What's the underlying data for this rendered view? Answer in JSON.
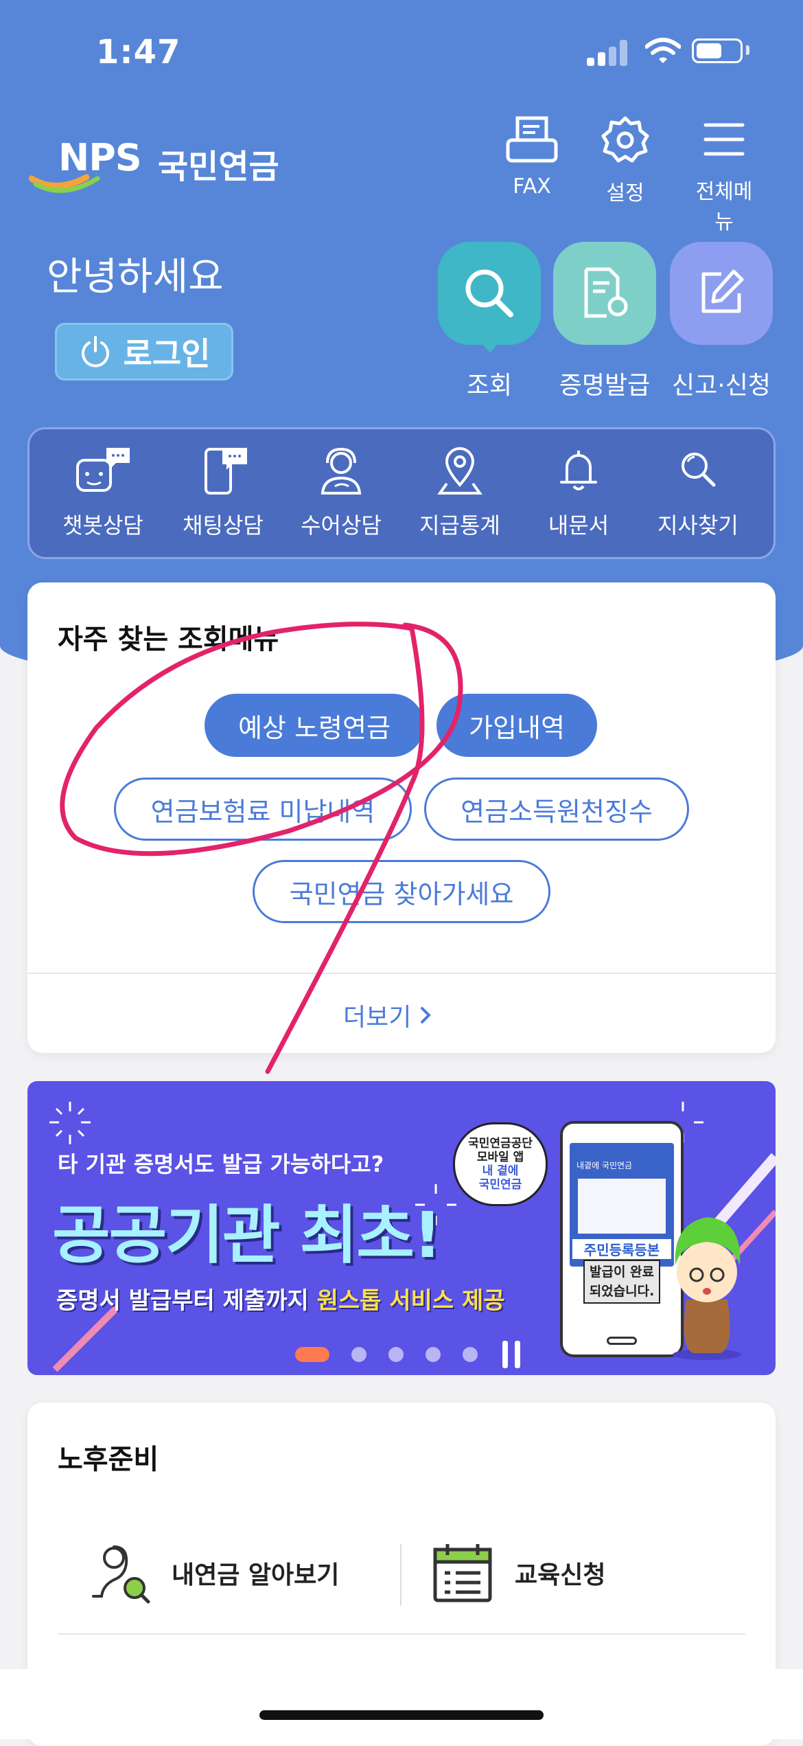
{
  "status_bar": {
    "time": "1:47"
  },
  "header": {
    "logo_brand": "NPS",
    "logo_name": "국민연금",
    "icons": [
      {
        "name": "fax-icon",
        "label": "FAX"
      },
      {
        "name": "gear-icon",
        "label": "설정"
      },
      {
        "name": "menu-icon",
        "label": "전체메뉴"
      }
    ]
  },
  "greeting": "안녕하세요",
  "login_label": "로그인",
  "quick_actions": [
    {
      "label": "조회",
      "icon": "search-icon",
      "color": "#3fb7c6"
    },
    {
      "label": "증명발급",
      "icon": "certificate-icon",
      "color": "#7fcfc9"
    },
    {
      "label": "신고·신청",
      "icon": "edit-icon",
      "color": "#8d9ef0"
    }
  ],
  "menu": [
    {
      "label": "챗봇상담",
      "icon": "chatbot-icon"
    },
    {
      "label": "채팅상담",
      "icon": "mobile-chat-icon"
    },
    {
      "label": "수어상담",
      "icon": "sign-language-icon"
    },
    {
      "label": "지급통계",
      "icon": "map-pin-icon"
    },
    {
      "label": "내문서",
      "icon": "bell-icon"
    },
    {
      "label": "지사찾기",
      "icon": "search-icon"
    }
  ],
  "frequent": {
    "title": "자주 찾는 조회메뉴",
    "chips": [
      {
        "label": "예상 노령연금"
      },
      {
        "label": "가입내역"
      },
      {
        "label": "연금보험료 미납내역"
      },
      {
        "label": "연금소득원천징수"
      },
      {
        "label": "국민연금 찾아가세요"
      }
    ],
    "more": "더보기"
  },
  "banner": {
    "question": "타 기관 증명서도 발급 가능하다고?",
    "headline": "공공기관 최초!",
    "sub_prefix": "증명서 발급부터 제출까지 ",
    "sub_highlight": "원스톱 서비스 제공",
    "bubble_line1": "국민연금공단",
    "bubble_line2": "모바일 앱",
    "bubble_line3": "내 곁에",
    "bubble_line4": "국민연금",
    "phone_title": "주민등록등본",
    "phone_msg1": "발급이 완료",
    "phone_msg2": "되었습니다.",
    "phone_header": "내곁에 국민연금",
    "page_count": 5,
    "active_page": 1
  },
  "retirement": {
    "title": "노후준비",
    "items": [
      {
        "label": "내연금 알아보기",
        "icon": "pension-search-icon"
      },
      {
        "label": "교육신청",
        "icon": "calendar-icon"
      }
    ]
  }
}
